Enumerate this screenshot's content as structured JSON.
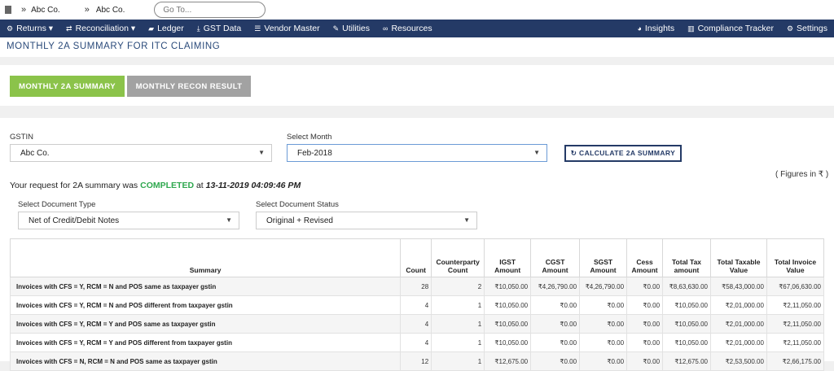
{
  "topbar": {
    "crumbs": [
      "Abc Co.",
      "Abc Co."
    ],
    "goto_placeholder": "Go To..."
  },
  "nav": {
    "left": [
      {
        "label": "Returns ▾",
        "icon": "gear-icon"
      },
      {
        "label": "Reconciliation ▾",
        "icon": "exchange-icon"
      },
      {
        "label": "Ledger",
        "icon": "book-icon"
      },
      {
        "label": "GST Data",
        "icon": "download-icon"
      },
      {
        "label": "Vendor Master",
        "icon": "database-icon"
      },
      {
        "label": "Utilities",
        "icon": "wrench-icon"
      },
      {
        "label": "Resources",
        "icon": "link-icon"
      }
    ],
    "right": [
      {
        "label": "Insights",
        "icon": "pie-chart-icon"
      },
      {
        "label": "Compliance Tracker",
        "icon": "bar-chart-icon"
      },
      {
        "label": "Settings",
        "icon": "gear-icon"
      }
    ]
  },
  "page": {
    "title": "MONTHLY 2A SUMMARY FOR ITC CLAIMING",
    "tabs": [
      "MONTHLY 2A SUMMARY",
      "MONTHLY RECON RESULT"
    ]
  },
  "form": {
    "gstin_label": "GSTIN",
    "gstin_value": "Abc Co.",
    "month_label": "Select Month",
    "month_value": "Feb-2018",
    "calc_button": "↻ CALCULATE 2A SUMMARY",
    "figures_note": "( Figures in ₹ )",
    "doc_type_label": "Select Document Type",
    "doc_type_value": "Net of Credit/Debit Notes",
    "doc_status_label": "Select Document Status",
    "doc_status_value": "Original + Revised"
  },
  "request": {
    "prefix": "Your request for 2A summary was",
    "status": "COMPLETED",
    "at": "at",
    "timestamp": "13-11-2019 04:09:46 PM"
  },
  "colors": {
    "navbar": "#243a66",
    "active_tab": "#8bc34a",
    "inactive_tab": "#a2a2a2",
    "completed": "#2fa84f"
  },
  "table": {
    "headers": [
      "Summary",
      "Count",
      "Counterparty Count",
      "IGST Amount",
      "CGST Amount",
      "SGST Amount",
      "Cess Amount",
      "Total Tax amount",
      "Total Taxable Value",
      "Total Invoice Value"
    ],
    "rows": [
      [
        "Invoices with CFS = Y, RCM = N and POS same as taxpayer gstin",
        "28",
        "2",
        "₹10,050.00",
        "₹4,26,790.00",
        "₹4,26,790.00",
        "₹0.00",
        "₹8,63,630.00",
        "₹58,43,000.00",
        "₹67,06,630.00"
      ],
      [
        "Invoices with CFS = Y, RCM = N and POS different from taxpayer gstin",
        "4",
        "1",
        "₹10,050.00",
        "₹0.00",
        "₹0.00",
        "₹0.00",
        "₹10,050.00",
        "₹2,01,000.00",
        "₹2,11,050.00"
      ],
      [
        "Invoices with CFS = Y, RCM = Y and POS same as taxpayer gstin",
        "4",
        "1",
        "₹10,050.00",
        "₹0.00",
        "₹0.00",
        "₹0.00",
        "₹10,050.00",
        "₹2,01,000.00",
        "₹2,11,050.00"
      ],
      [
        "Invoices with CFS = Y, RCM = Y and POS different from taxpayer gstin",
        "4",
        "1",
        "₹10,050.00",
        "₹0.00",
        "₹0.00",
        "₹0.00",
        "₹10,050.00",
        "₹2,01,000.00",
        "₹2,11,050.00"
      ],
      [
        "Invoices with CFS = N, RCM = N and POS same as taxpayer gstin",
        "12",
        "1",
        "₹12,675.00",
        "₹0.00",
        "₹0.00",
        "₹0.00",
        "₹12,675.00",
        "₹2,53,500.00",
        "₹2,66,175.00"
      ]
    ]
  }
}
